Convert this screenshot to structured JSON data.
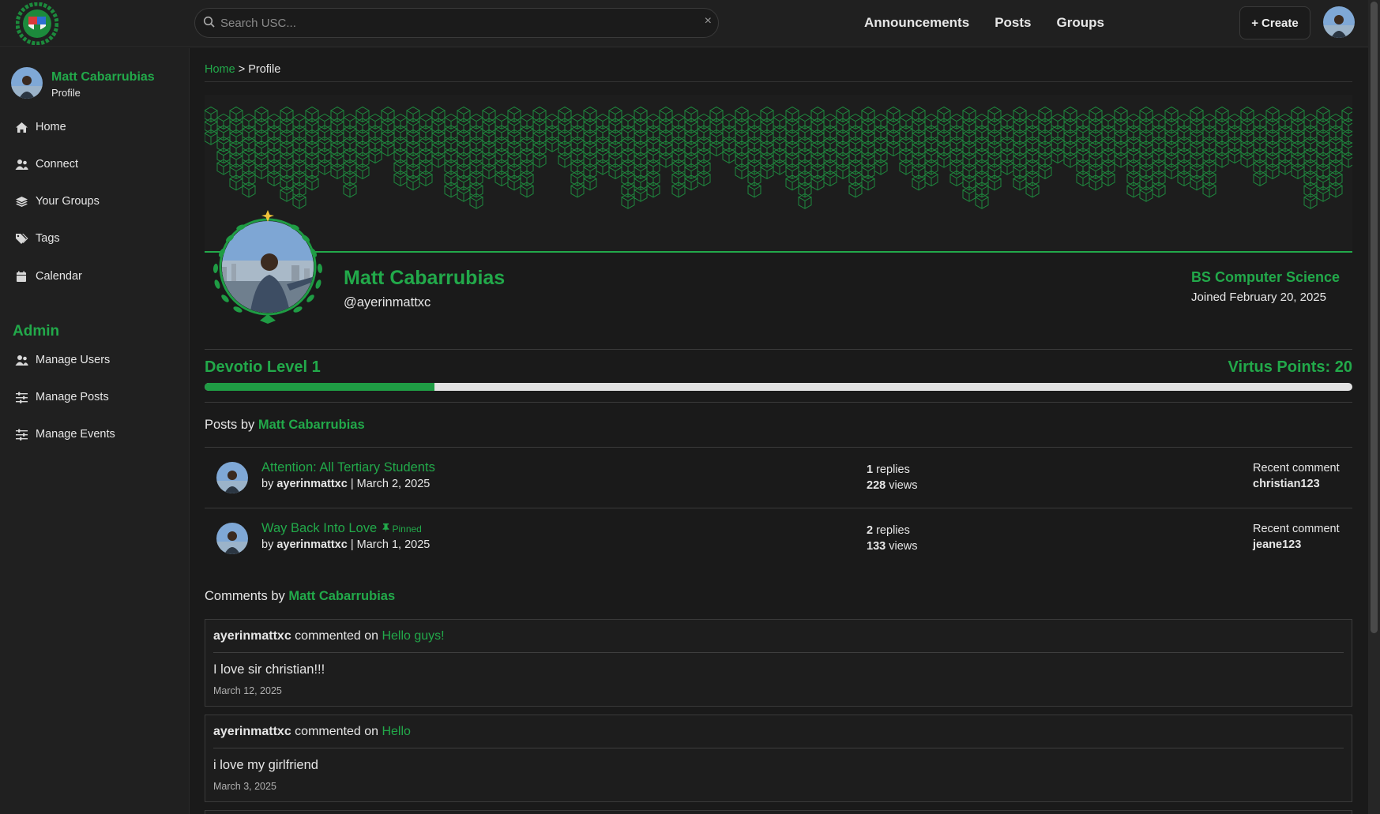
{
  "header": {
    "search_placeholder": "Search USC...",
    "clear_label": "×",
    "nav": [
      "Announcements",
      "Posts",
      "Groups"
    ],
    "create_label": "Create"
  },
  "sidebar": {
    "user_name": "Matt Cabarrubias",
    "user_sub": "Profile",
    "items": [
      "Home",
      "Connect",
      "Your Groups",
      "Tags",
      "Calendar"
    ],
    "admin_title": "Admin",
    "admin_items": [
      "Manage Users",
      "Manage Posts",
      "Manage Events"
    ]
  },
  "breadcrumb": {
    "home": "Home",
    "sep": " > ",
    "current": "Profile"
  },
  "profile": {
    "name": "Matt Cabarrubias",
    "handle": "@ayerinmattxc",
    "program": "BS Computer Science",
    "joined": "Joined February 20, 2025",
    "level": "Devotio Level 1",
    "points": "Virtus Points: 20",
    "progress": 0.2
  },
  "posts_section": {
    "prefix": "Posts by ",
    "name": "Matt Cabarrubias"
  },
  "posts": [
    {
      "title": "Attention: All Tertiary Students",
      "pinned": "",
      "by": "by ",
      "author": "ayerinmattxc",
      "date": " | March 2, 2025",
      "replies": "1",
      "replies_label": " replies",
      "views": "228",
      "views_label": " views",
      "recent_label": "Recent comment",
      "recent_user": "christian123"
    },
    {
      "title": "Way Back Into Love",
      "pinned": "Pinned",
      "by": "by ",
      "author": "ayerinmattxc",
      "date": " | March 1, 2025",
      "replies": "2",
      "replies_label": " replies",
      "views": "133",
      "views_label": " views",
      "recent_label": "Recent comment",
      "recent_user": "jeane123"
    }
  ],
  "comments_section": {
    "prefix": "Comments by ",
    "name": "Matt Cabarrubias"
  },
  "comments": [
    {
      "user": "ayerinmattxc",
      "mid": " commented on ",
      "post": "Hello guys!",
      "text": "I love sir christian!!!",
      "date": "March 12, 2025"
    },
    {
      "user": "ayerinmattxc",
      "mid": " commented on ",
      "post": "Hello",
      "text": "i love my girlfriend",
      "date": "March 3, 2025"
    }
  ],
  "colors": {
    "accent": "#22a94a",
    "background": "#1a1a1a",
    "panel": "#202020"
  }
}
